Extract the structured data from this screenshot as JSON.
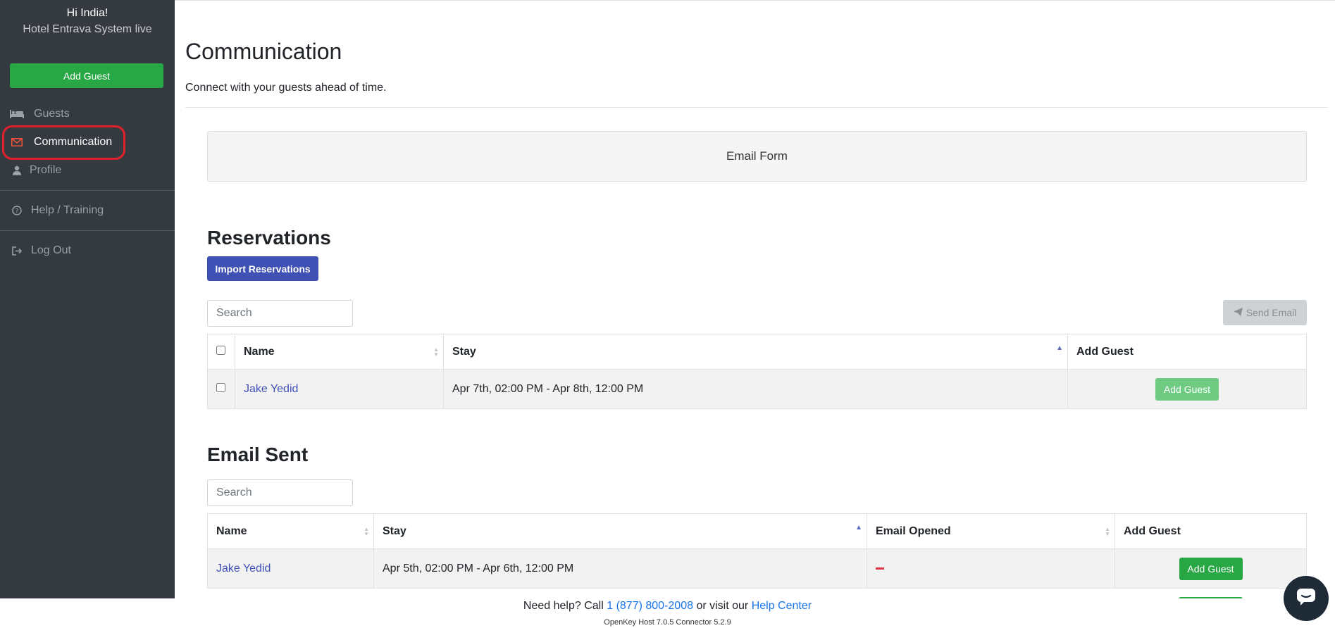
{
  "sidebar": {
    "greeting": "Hi India!",
    "hotel_name": "Hotel Entrava System live",
    "add_guest_label": "Add Guest",
    "items": [
      {
        "label": "Guests",
        "icon": "bed-icon"
      },
      {
        "label": "Communication",
        "icon": "envelope-icon",
        "active": true
      },
      {
        "label": "Profile",
        "icon": "user-icon"
      },
      {
        "label": "Help / Training",
        "icon": "question-circle-icon"
      },
      {
        "label": "Log Out",
        "icon": "sign-out-icon"
      }
    ]
  },
  "main": {
    "title": "Communication",
    "subtitle": "Connect with your guests ahead of time.",
    "email_form_label": "Email Form"
  },
  "reservations": {
    "title": "Reservations",
    "import_label": "Import Reservations",
    "search_placeholder": "Search",
    "send_email_label": "Send Email",
    "columns": [
      "Name",
      "Stay",
      "Add Guest"
    ],
    "rows": [
      {
        "name": "Jake Yedid",
        "stay": "Apr 7th, 02:00 PM - Apr 8th, 12:00 PM",
        "action": "Add Guest"
      }
    ]
  },
  "email_sent": {
    "title": "Email Sent",
    "search_placeholder": "Search",
    "columns": [
      "Name",
      "Stay",
      "Email Opened",
      "Add Guest"
    ],
    "rows": [
      {
        "name": "Jake Yedid",
        "stay": "Apr 5th, 02:00 PM - Apr 6th, 12:00 PM",
        "opened": "",
        "action": "Add Guest"
      }
    ]
  },
  "footer": {
    "help_prefix": "Need help? Call",
    "phone": "1 (877) 800-2008",
    "help_middle": "or visit our",
    "help_center": "Help Center",
    "version": "OpenKey Host 7.0.5   Connector 5.2.9"
  },
  "colors": {
    "sidebar_bg": "#343a40",
    "success": "#28a745",
    "primary": "#3f51b5",
    "highlight": "#e0202a",
    "danger": "#dc3545"
  }
}
